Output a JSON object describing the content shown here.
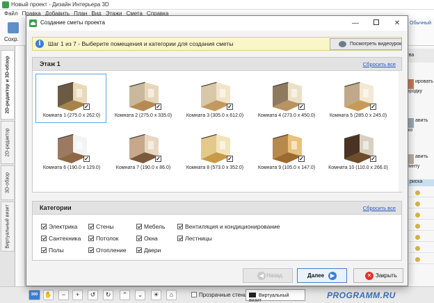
{
  "app": {
    "title": "Новый проект - Дизайн Интерьера 3D",
    "menu": [
      "Файл",
      "Правка",
      "Добавить",
      "План",
      "Вид",
      "Этажи",
      "Смета",
      "Справка"
    ],
    "save_label": "Сохр.",
    "top_right_link": "Обычный",
    "vertical_tabs": [
      "2D-редактор и 3D-обзор",
      "2D-редактор",
      "3D-обзор",
      "Виртуальный визит"
    ],
    "right_panel": {
      "head": "ства",
      "items": [
        "ировать породку",
        "авить юко",
        "авить плинту"
      ],
      "bar": "риска"
    },
    "bottom": {
      "tools": [
        "360",
        "hand-icon",
        "zoom-out-icon",
        "zoom-in-icon",
        "rotate-left-icon",
        "rotate-right-icon",
        "tilt-up-icon",
        "tilt-down-icon",
        "light-icon",
        "home-icon"
      ],
      "transparent_walls": "Прозрачные стены",
      "virtual_visit": "Виртуальный визит",
      "watermark": "PROGRAMM.RU"
    }
  },
  "dialog": {
    "title": "Создание сметы проекта",
    "step_text": "Шаг 1 из 7 - Выберите помещения и категории для создания сметы",
    "video_button": "Посмотреть видеоурок",
    "floor": {
      "title": "Этаж 1",
      "reset_link": "Сбросить все",
      "rooms": [
        {
          "label": "Комната 1 (275.0 x 262.0)",
          "checked": true,
          "selected": true,
          "colors": [
            "#6b5a44",
            "#e9d9b8",
            "#a8824b"
          ]
        },
        {
          "label": "Комната 2 (275.0 x 335.0)",
          "checked": true,
          "selected": false,
          "colors": [
            "#c9b89c",
            "#e6d7bb",
            "#b58b55"
          ]
        },
        {
          "label": "Комната 3 (305.0 x 612.0)",
          "checked": true,
          "selected": false,
          "colors": [
            "#d8c7a8",
            "#f1e4c9",
            "#c29a5e"
          ]
        },
        {
          "label": "Комната 4 (273.0 x 450.0)",
          "checked": true,
          "selected": false,
          "colors": [
            "#8e7a5f",
            "#ece0c6",
            "#b89363"
          ]
        },
        {
          "label": "Комната 5 (285.0 x 245.0)",
          "checked": true,
          "selected": false,
          "colors": [
            "#bfa98a",
            "#f2e8d3",
            "#c89a5a"
          ]
        },
        {
          "label": "Комната 6 (190.0 x 129.0)",
          "checked": true,
          "selected": false,
          "colors": [
            "#9a7b62",
            "#f3f3f3",
            "#8d6845"
          ]
        },
        {
          "label": "Комната 7 (190.0 x 86.0)",
          "checked": true,
          "selected": false,
          "colors": [
            "#c7a88a",
            "#e8d7c1",
            "#7b5a3c"
          ]
        },
        {
          "label": "Комната 8 (573.0 x 352.0)",
          "checked": true,
          "selected": false,
          "colors": [
            "#e3c98a",
            "#f2e4bb",
            "#c79a46"
          ]
        },
        {
          "label": "Комната 9 (105.0 x 147.0)",
          "checked": true,
          "selected": false,
          "colors": [
            "#b8894c",
            "#e8c27a",
            "#9c6a2f"
          ]
        },
        {
          "label": "Комната 10 (110.0 x 266.0)",
          "checked": true,
          "selected": false,
          "colors": [
            "#4a3322",
            "#d9d0c2",
            "#6e4d2c"
          ]
        }
      ]
    },
    "categories": {
      "title": "Категории",
      "reset_link": "Сбросить все",
      "items": [
        {
          "label": "Электрика",
          "checked": true
        },
        {
          "label": "Сантехника",
          "checked": true
        },
        {
          "label": "Полы",
          "checked": true
        },
        {
          "label": "Стены",
          "checked": true
        },
        {
          "label": "Потолок",
          "checked": true
        },
        {
          "label": "Отопление",
          "checked": true
        },
        {
          "label": "Мебель",
          "checked": true
        },
        {
          "label": "Окна",
          "checked": true
        },
        {
          "label": "Двери",
          "checked": true
        },
        {
          "label": "Вентиляция и кондиционирование",
          "checked": true
        },
        {
          "label": "Лестницы",
          "checked": true
        }
      ]
    },
    "buttons": {
      "back": "Назад",
      "next": "Далее",
      "close": "Закрыть",
      "back_enabled": false
    },
    "colors": {
      "accent": "#3a7fd6",
      "banner": "#faf6c8",
      "close_icon": "#d9342b"
    }
  }
}
